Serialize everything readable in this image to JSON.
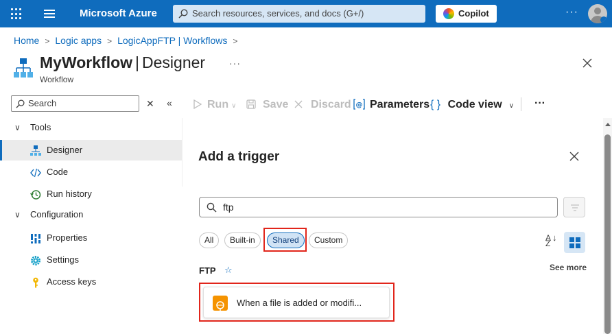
{
  "topbar": {
    "brand": "Microsoft Azure",
    "search_placeholder": "Search resources, services, and docs (G+/)",
    "copilot_label": "Copilot",
    "more": "···"
  },
  "breadcrumb": [
    "Home",
    "Logic apps",
    "LogicAppFTP | Workflows"
  ],
  "page": {
    "title_bold": "MyWorkflow",
    "title_rest": "Designer",
    "subtitle": "Workflow",
    "more": "···"
  },
  "sidebar": {
    "search_placeholder": "Search",
    "groups": [
      {
        "label": "Tools",
        "items": [
          "Designer",
          "Code",
          "Run history"
        ]
      },
      {
        "label": "Configuration",
        "items": [
          "Properties",
          "Settings",
          "Access keys"
        ]
      }
    ],
    "active_item": "Designer"
  },
  "toolbar": {
    "run": "Run",
    "save": "Save",
    "discard": "Discard",
    "parameters": "Parameters",
    "code_view": "Code view",
    "more": "···"
  },
  "panel": {
    "title": "Add a trigger",
    "search_value": "ftp",
    "filters": [
      "All",
      "Built-in",
      "Shared",
      "Custom"
    ],
    "selected_filter": "Shared",
    "connector": "FTP",
    "see_more": "See more",
    "trigger": "When a file is added or modifi..."
  },
  "colors": {
    "accent": "#0f6cbd",
    "highlight_box": "#e1251b",
    "ftp_icon": "#f59300"
  }
}
